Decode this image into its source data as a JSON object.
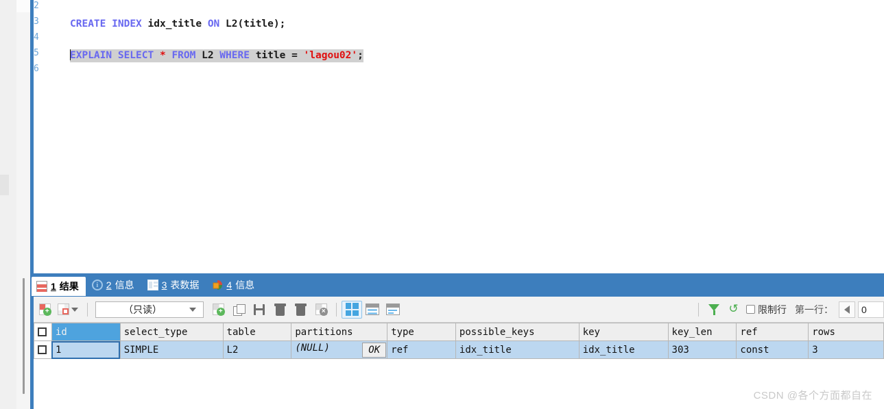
{
  "editor": {
    "line_numbers": [
      "2",
      "3",
      "4",
      "5",
      "6"
    ],
    "lines": [
      {
        "n": "2",
        "segments": []
      },
      {
        "n": "3",
        "segments": [
          {
            "t": "CREATE",
            "c": "kw"
          },
          {
            "t": " ",
            "c": "op"
          },
          {
            "t": "INDEX",
            "c": "kw"
          },
          {
            "t": " ",
            "c": "op"
          },
          {
            "t": "idx_title",
            "c": "id"
          },
          {
            "t": " ",
            "c": "op"
          },
          {
            "t": "ON",
            "c": "kw"
          },
          {
            "t": " ",
            "c": "op"
          },
          {
            "t": "L2",
            "c": "id"
          },
          {
            "t": "(title);",
            "c": "op"
          }
        ]
      },
      {
        "n": "4",
        "segments": []
      },
      {
        "n": "5",
        "highlighted": true,
        "segments": [
          {
            "t": "EXPLAIN",
            "c": "kw"
          },
          {
            "t": " ",
            "c": "op"
          },
          {
            "t": "SELECT",
            "c": "kw"
          },
          {
            "t": " ",
            "c": "op"
          },
          {
            "t": "*",
            "c": "star"
          },
          {
            "t": " ",
            "c": "op"
          },
          {
            "t": "FROM",
            "c": "kw"
          },
          {
            "t": " ",
            "c": "op"
          },
          {
            "t": "L2",
            "c": "id"
          },
          {
            "t": " ",
            "c": "op"
          },
          {
            "t": "WHERE",
            "c": "kw"
          },
          {
            "t": " ",
            "c": "op"
          },
          {
            "t": "title",
            "c": "id"
          },
          {
            "t": " = ",
            "c": "op"
          },
          {
            "t": "'lagou02'",
            "c": "str"
          },
          {
            "t": ";",
            "c": "op"
          }
        ]
      },
      {
        "n": "6",
        "segments": []
      }
    ],
    "plain_text": "CREATE INDEX idx_title ON L2(title);\n\nEXPLAIN SELECT * FROM L2 WHERE title = 'lagou02';"
  },
  "result_tabs": [
    {
      "num": "1",
      "label": "结果",
      "icon": "result-grid-icon",
      "active": true
    },
    {
      "num": "2",
      "label": "信息",
      "icon": "info-circle-icon",
      "active": false
    },
    {
      "num": "3",
      "label": "表数据",
      "icon": "table-data-icon",
      "active": false
    },
    {
      "num": "4",
      "label": "信息",
      "icon": "pie-chart-icon",
      "active": false
    }
  ],
  "grid_toolbar": {
    "mode_value": "（只读）",
    "mode_options": [
      "（只读）"
    ],
    "buttons": [
      {
        "name": "add-record-button",
        "icon": "grid-plus-icon"
      },
      {
        "name": "record-options-button",
        "icon": "grid-red-dropdown-icon"
      },
      {
        "name": "insert-record-button",
        "icon": "grid-insert-icon"
      },
      {
        "name": "duplicate-record-button",
        "icon": "copy-icon"
      },
      {
        "name": "save-record-button",
        "icon": "save-icon"
      },
      {
        "name": "delete-record-button",
        "icon": "trash-icon"
      },
      {
        "name": "remove-record-button",
        "icon": "grid-remove-icon"
      }
    ],
    "view_modes": [
      {
        "name": "grid-view-button",
        "icon": "grid-view-icon",
        "selected": true
      },
      {
        "name": "form-view-button",
        "icon": "form-view-icon",
        "selected": false
      },
      {
        "name": "text-view-button",
        "icon": "text-view-icon",
        "selected": false
      }
    ],
    "filter_icon": "funnel-icon",
    "refresh_icon": "refresh-icon",
    "limit_rows_label": "限制行",
    "limit_rows_checked": false,
    "first_row_label": "第一行：",
    "first_row_value": "0"
  },
  "result_grid": {
    "columns": [
      "id",
      "select_type",
      "table",
      "partitions",
      "type",
      "possible_keys",
      "key",
      "key_len",
      "ref",
      "rows"
    ],
    "selected_column": "id",
    "rows": [
      {
        "id": "1",
        "select_type": "SIMPLE",
        "table": "L2",
        "partitions": "(NULL)",
        "partitions_button": "OK",
        "type": "ref",
        "possible_keys": "idx_title",
        "key": "idx_title",
        "key_len": "303",
        "ref": "const",
        "rows": "3"
      }
    ]
  },
  "watermark": "CSDN @各个方面都自在",
  "colors": {
    "accent_blue": "#3d7ebd",
    "header_select": "#4ea3de",
    "row_select": "#bcd7f0",
    "keyword": "#6868f0",
    "string": "#e01010",
    "toolbar_bg": "#f2f2f2"
  }
}
